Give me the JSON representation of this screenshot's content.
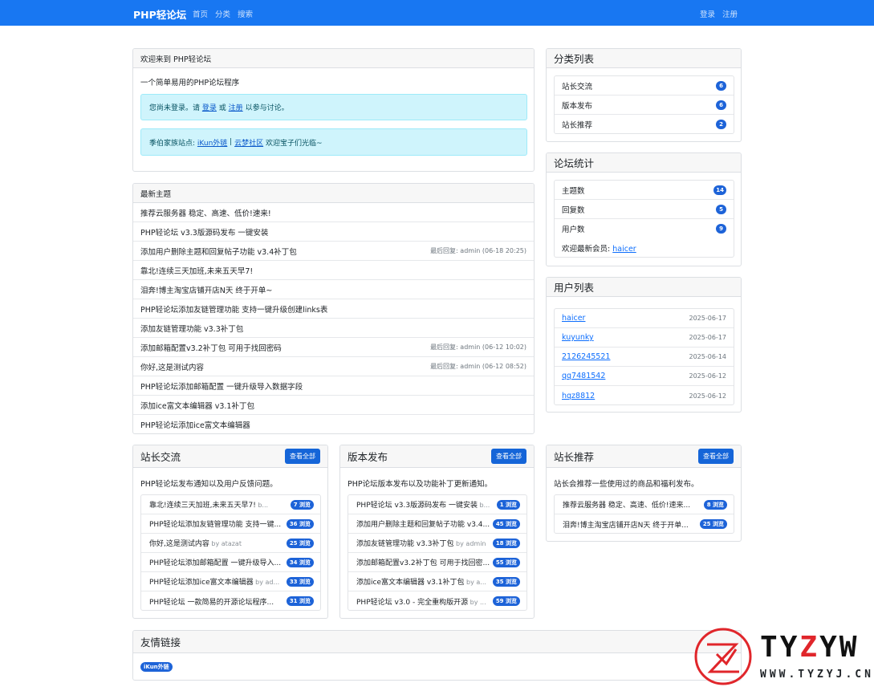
{
  "nav": {
    "brand": "PHP轻论坛",
    "links": [
      "首页",
      "分类",
      "搜索"
    ],
    "login": "登录",
    "register": "注册"
  },
  "welcome": {
    "title": "欢迎来到 PHP轻论坛",
    "subtitle": "一个简单易用的PHP论坛程序",
    "login_prompt": {
      "pre": "您尚未登录。请",
      "login": "登录",
      "or": "或",
      "register": "注册",
      "post": "以参与讨论。"
    },
    "family": {
      "pre": "季伯家族站点:",
      "link1": "iKun外链",
      "sep": "|",
      "link2": "云梦社区",
      "post": "欢迎宝子们光临~"
    }
  },
  "latest": {
    "title": "最新主题",
    "items": [
      {
        "title": "推荐云服务器 稳定、高速、低价!速来!",
        "reply": ""
      },
      {
        "title": "PHP轻论坛 v3.3版源码发布 一键安装",
        "reply": ""
      },
      {
        "title": "添加用户删除主题和回复帖子功能 v3.4补丁包",
        "reply": "最后回复: admin (06-18 20:25)"
      },
      {
        "title": "靠北!连续三天加班,未来五天早7!",
        "reply": ""
      },
      {
        "title": "泪奔!博主淘宝店铺开店N天 终于开单~",
        "reply": ""
      },
      {
        "title": "PHP轻论坛添加友链管理功能 支持一键升级创建links表",
        "reply": ""
      },
      {
        "title": "添加友链管理功能 v3.3补丁包",
        "reply": ""
      },
      {
        "title": "添加邮箱配置v3.2补丁包 可用于找回密码",
        "reply": "最后回复: admin (06-12 10:02)"
      },
      {
        "title": "你好,这是测试内容",
        "reply": "最后回复: admin (06-12 08:52)"
      },
      {
        "title": "PHP轻论坛添加邮箱配置 一键升级导入数据字段",
        "reply": ""
      },
      {
        "title": "添加ice富文本编辑器 v3.1补丁包",
        "reply": ""
      },
      {
        "title": "PHP轻论坛添加ice富文本编辑器",
        "reply": ""
      }
    ]
  },
  "categories": {
    "title": "分类列表",
    "items": [
      {
        "name": "站长交流",
        "count": "6"
      },
      {
        "name": "版本发布",
        "count": "6"
      },
      {
        "name": "站长推荐",
        "count": "2"
      }
    ]
  },
  "stats": {
    "title": "论坛统计",
    "items": [
      {
        "name": "主题数",
        "count": "14"
      },
      {
        "name": "回复数",
        "count": "5"
      },
      {
        "name": "用户数",
        "count": "9"
      }
    ],
    "newest_label": "欢迎最新会员:",
    "newest_user": "haicer"
  },
  "users": {
    "title": "用户列表",
    "items": [
      {
        "name": "haicer",
        "date": "2025-06-17"
      },
      {
        "name": "kuyunky",
        "date": "2025-06-17"
      },
      {
        "name": "2126245521",
        "date": "2025-06-14"
      },
      {
        "name": "qq7481542",
        "date": "2025-06-12"
      },
      {
        "name": "hqz8812",
        "date": "2025-06-12"
      }
    ]
  },
  "sections": [
    {
      "title": "站长交流",
      "button": "查看全部",
      "desc": "PHP轻论坛发布通知以及用户反馈问题。",
      "items": [
        {
          "title": "靠北!连续三天加班,未来五天早7!",
          "by": "b...",
          "views": "7 浏览"
        },
        {
          "title": "PHP轻论坛添加友链管理功能 支持一键...",
          "by": "",
          "views": "36 浏览"
        },
        {
          "title": "你好,这是测试内容",
          "by": "by atazat",
          "views": "25 浏览"
        },
        {
          "title": "PHP轻论坛添加邮箱配置 一键升级导入...",
          "by": "",
          "views": "34 浏览"
        },
        {
          "title": "PHP轻论坛添加ice富文本编辑器",
          "by": "by ad...",
          "views": "33 浏览"
        },
        {
          "title": "PHP轻论坛 一款简易的开源论坛程序...",
          "by": "",
          "views": "31 浏览"
        }
      ]
    },
    {
      "title": "版本发布",
      "button": "查看全部",
      "desc": "PHP论坛版本发布以及功能补丁更新通知。",
      "items": [
        {
          "title": "PHP轻论坛 v3.3版源码发布 一键安装",
          "by": "b...",
          "views": "1 浏览"
        },
        {
          "title": "添加用户删除主题和回复帖子功能 v3.4...",
          "by": "",
          "views": "45 浏览"
        },
        {
          "title": "添加友链管理功能 v3.3补丁包",
          "by": "by admin",
          "views": "18 浏览"
        },
        {
          "title": "添加邮箱配置v3.2补丁包 可用于找回密...",
          "by": "",
          "views": "55 浏览"
        },
        {
          "title": "添加ice富文本编辑器 v3.1补丁包",
          "by": "by a...",
          "views": "35 浏览"
        },
        {
          "title": "PHP轻论坛 v3.0 - 完全重构版开源",
          "by": "by ...",
          "views": "59 浏览"
        }
      ]
    },
    {
      "title": "站长推荐",
      "button": "查看全部",
      "desc": "站长会推荐一些使用过的商品和福利发布。",
      "items": [
        {
          "title": "推荐云服务器 稳定、高速、低价!速来...",
          "by": "",
          "views": "8 浏览"
        },
        {
          "title": "泪奔!博主淘宝店铺开店N天 终于开单...",
          "by": "",
          "views": "25 浏览"
        }
      ]
    }
  ],
  "links": {
    "title": "友情链接",
    "items": [
      "iKun外链"
    ]
  },
  "watermark": {
    "brand": "TYZYW",
    "url": "WWW.TYZYJ.CN",
    "color_red": "#e0262b"
  }
}
